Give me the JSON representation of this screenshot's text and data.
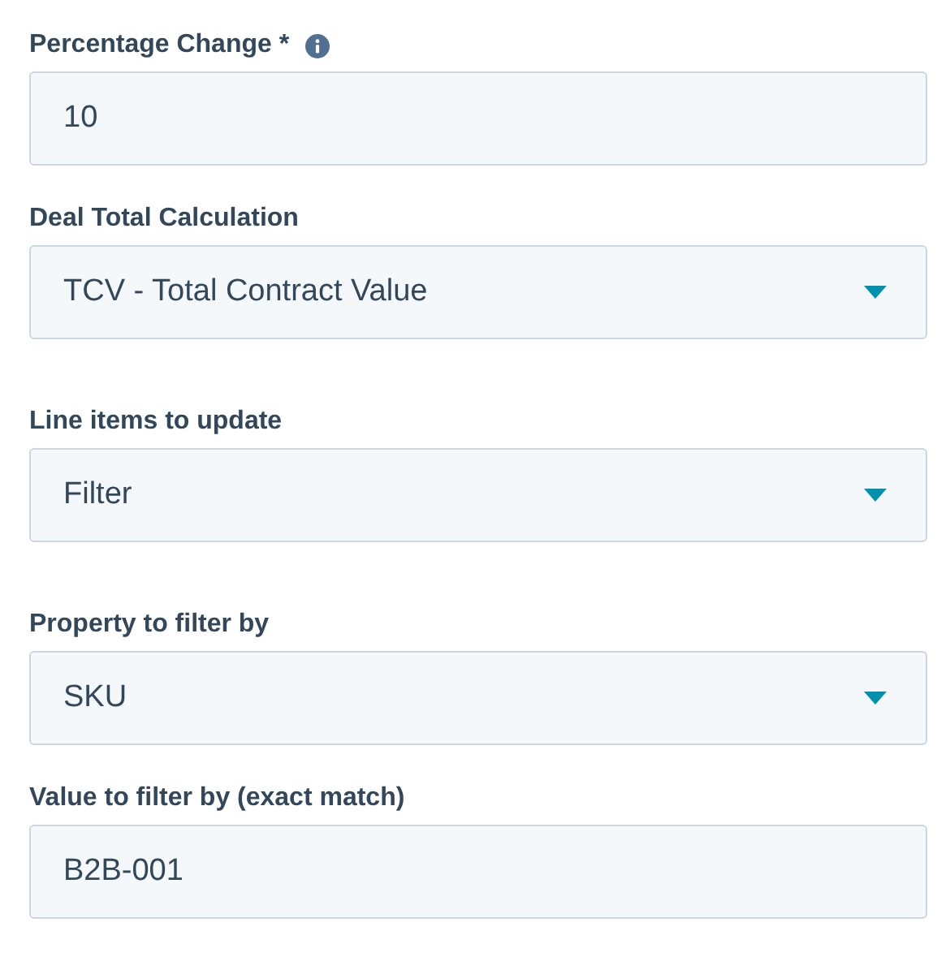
{
  "fields": [
    {
      "kind": "text",
      "label": "Percentage Change *",
      "info": true,
      "value": "10"
    },
    {
      "kind": "select",
      "label": "Deal Total Calculation",
      "info": false,
      "value": "TCV - Total Contract Value"
    },
    {
      "kind": "select",
      "label": "Line items to update",
      "info": false,
      "value": "Filter"
    },
    {
      "kind": "select",
      "label": "Property to filter by",
      "info": false,
      "value": "SKU"
    },
    {
      "kind": "text",
      "label": "Value to filter by (exact match)",
      "info": false,
      "value": "B2B-001"
    }
  ]
}
